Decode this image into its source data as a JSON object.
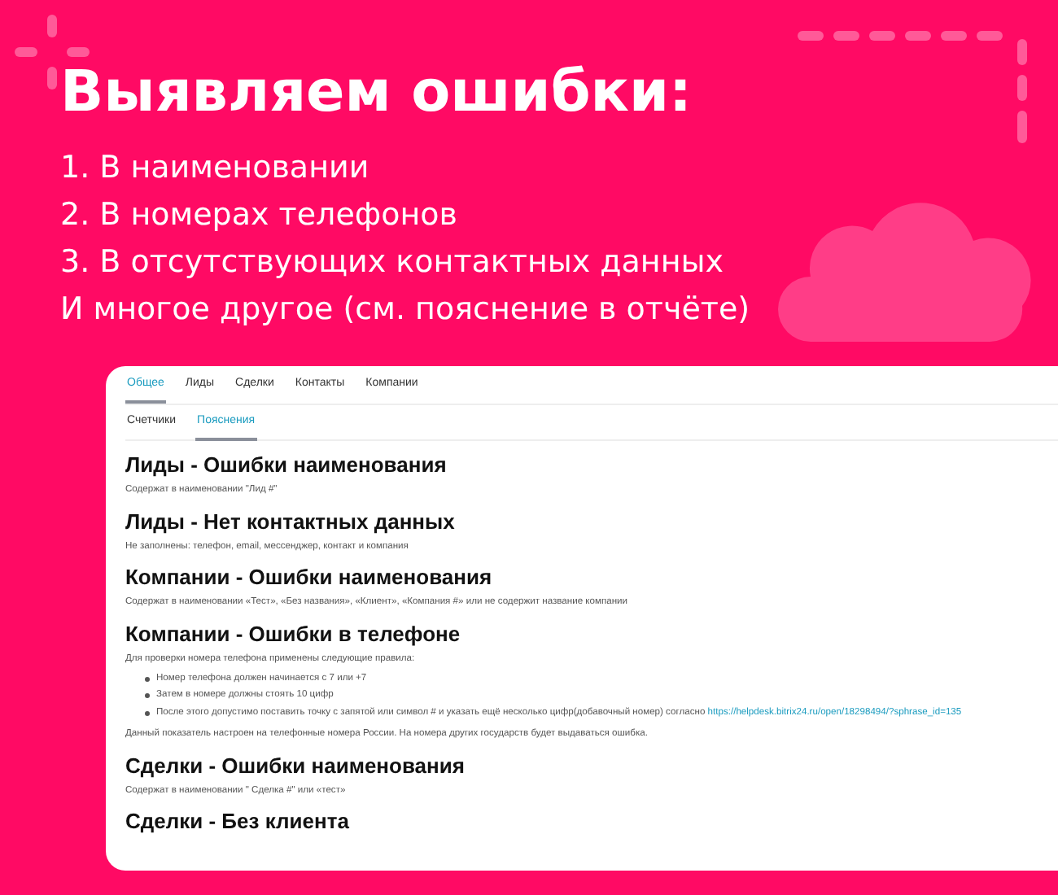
{
  "headline": "Выявляем ошибки:",
  "points": [
    "1. В наименовании",
    "2. В номерах телефонов",
    "3. В отсутствующих контактных данных",
    "И многое другое (см. пояснение в отчёте)"
  ],
  "report": {
    "tabs": [
      {
        "label": "Общее",
        "selected": true
      },
      {
        "label": "Лиды",
        "selected": false
      },
      {
        "label": "Сделки",
        "selected": false
      },
      {
        "label": "Контакты",
        "selected": false
      },
      {
        "label": "Компании",
        "selected": false
      }
    ],
    "subtabs": [
      {
        "label": "Счетчики",
        "selected": false
      },
      {
        "label": "Пояснения",
        "selected": true
      }
    ],
    "sections": [
      {
        "title": "Лиды - Ошибки наименования",
        "blocks": [
          {
            "kind": "text",
            "text": "Содержат в наименовании \"Лид #\""
          }
        ]
      },
      {
        "title": "Лиды - Нет контактных данных",
        "blocks": [
          {
            "kind": "text",
            "text": "Не заполнены: телефон, email, мессенджер, контакт и компания"
          }
        ]
      },
      {
        "title": "Компании - Ошибки наименования",
        "blocks": [
          {
            "kind": "text",
            "text": "Содержат в наименовании «Тест», «Без названия», «Клиент», «Компания #» или не содержит название компании"
          }
        ]
      },
      {
        "title": "Компании - Ошибки в телефоне",
        "blocks": [
          {
            "kind": "text",
            "text": "Для проверки номера телефона применены следующие правила:"
          },
          {
            "kind": "bullets",
            "items": [
              {
                "text": "Номер телефона должен начинается с 7 или +7"
              },
              {
                "text": "Затем в номере должны стоять 10 цифр"
              },
              {
                "text": "После этого допустимо поставить точку с запятой или символ # и указать ещё несколько цифр(добавочный номер) согласно",
                "link": "https://helpdesk.bitrix24.ru/open/18298494/?sphrase_id=135"
              }
            ]
          },
          {
            "kind": "text",
            "text": "Данный показатель настроен на телефонные номера России. На номера других государств будет выдаваться ошибка."
          }
        ]
      },
      {
        "title": "Сделки - Ошибки наименования",
        "blocks": [
          {
            "kind": "text",
            "text": "Содержат в наименовании \" Сделка #\" или «тест»"
          }
        ]
      },
      {
        "title": "Сделки - Без клиента"
      }
    ]
  }
}
